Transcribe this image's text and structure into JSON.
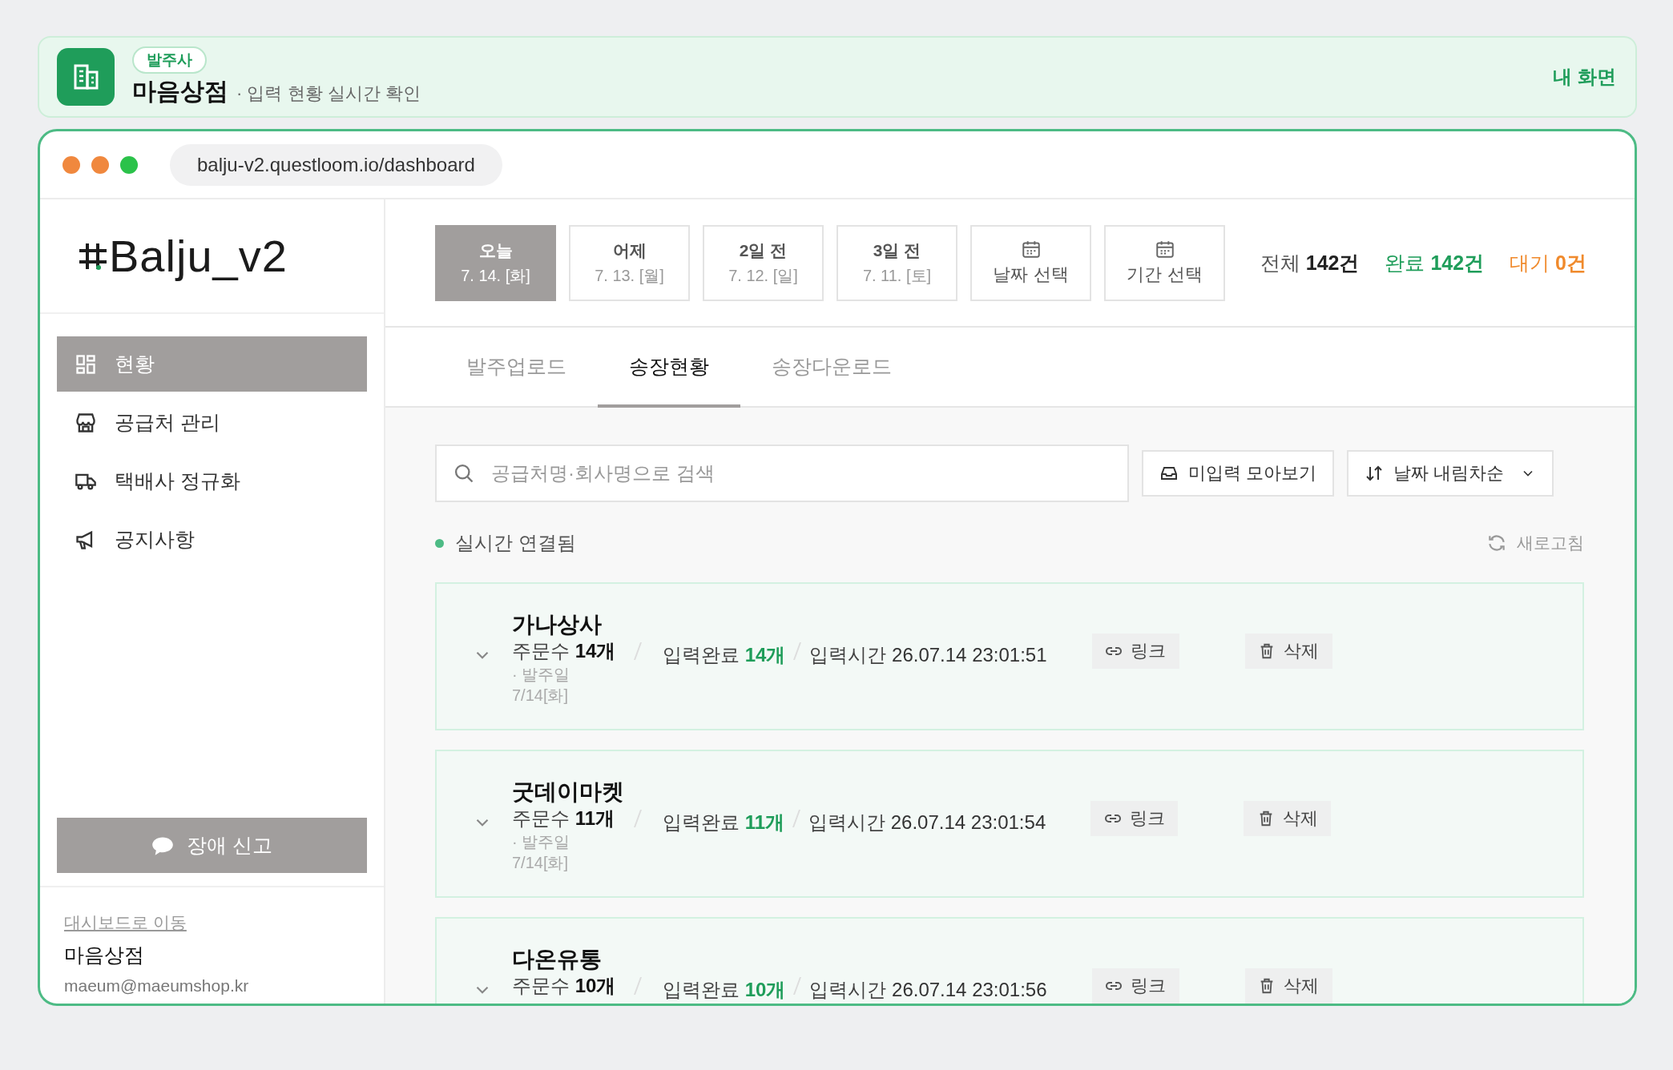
{
  "banner": {
    "badge": "발주사",
    "title": "마음상점",
    "subtitle": "· 입력 현황 실시간 확인",
    "action": "내 화면"
  },
  "browser": {
    "url": "balju-v2.questloom.io/dashboard"
  },
  "sidebar": {
    "logo": "Balju_v2",
    "items": [
      {
        "label": "현황",
        "selected": true
      },
      {
        "label": "공급처 관리",
        "selected": false
      },
      {
        "label": "택배사 정규화",
        "selected": false
      },
      {
        "label": "공지사항",
        "selected": false
      }
    ],
    "report_button": "장애 신고",
    "footer": {
      "link": "대시보드로 이동",
      "name": "마음상점",
      "email": "maeum@maeumshop.kr"
    }
  },
  "date_filters": [
    {
      "kind": "day",
      "label": "오늘",
      "date": "7. 14. [화]",
      "selected": true
    },
    {
      "kind": "day",
      "label": "어제",
      "date": "7. 13. [월]",
      "selected": false
    },
    {
      "kind": "day",
      "label": "2일 전",
      "date": "7. 12. [일]",
      "selected": false
    },
    {
      "kind": "day",
      "label": "3일 전",
      "date": "7. 11. [토]",
      "selected": false
    },
    {
      "kind": "picker",
      "label": "날짜 선택",
      "selected": false
    },
    {
      "kind": "picker",
      "label": "기간 선택",
      "selected": false
    }
  ],
  "stats": [
    {
      "label": "전체",
      "value": "142건",
      "color": "#222222"
    },
    {
      "label": "완료",
      "value": "142건",
      "color": "#1f9d5a"
    },
    {
      "label": "대기",
      "value": "0건",
      "color": "#f08a2c"
    }
  ],
  "tabs": [
    {
      "label": "발주업로드",
      "selected": false
    },
    {
      "label": "송장현황",
      "selected": true
    },
    {
      "label": "송장다운로드",
      "selected": false
    }
  ],
  "search": {
    "placeholder": "공급처명·회사명으로 검색"
  },
  "toolbar_buttons": [
    {
      "kind": "inbox",
      "label": "미입력 모아보기"
    },
    {
      "kind": "sort",
      "label": "날짜 내림차순"
    }
  ],
  "live": {
    "label": "실시간 연결됨",
    "connected": true
  },
  "refresh": "새로고침",
  "suppliers": [
    {
      "name": "가나상사",
      "order_label": "주문수",
      "order_count": "14개",
      "date_label": "· 발주일",
      "date": "7/14[화]",
      "done_label": "입력완료",
      "done_count": "14개",
      "time_label": "입력시간",
      "time": "26.07.14 23:01:51",
      "link": "링크",
      "delete": "삭제"
    },
    {
      "name": "굿데이마켓",
      "order_label": "주문수",
      "order_count": "11개",
      "date_label": "· 발주일",
      "date": "7/14[화]",
      "done_label": "입력완료",
      "done_count": "11개",
      "time_label": "입력시간",
      "time": "26.07.14 23:01:54",
      "link": "링크",
      "delete": "삭제"
    },
    {
      "name": "다온유통",
      "order_label": "주문수",
      "order_count": "10개",
      "done_label": "입력완료",
      "done_count": "10개",
      "time_label": "입력시간",
      "time": "26.07.14 23:01:56",
      "link": "링크",
      "delete": "삭제"
    }
  ]
}
